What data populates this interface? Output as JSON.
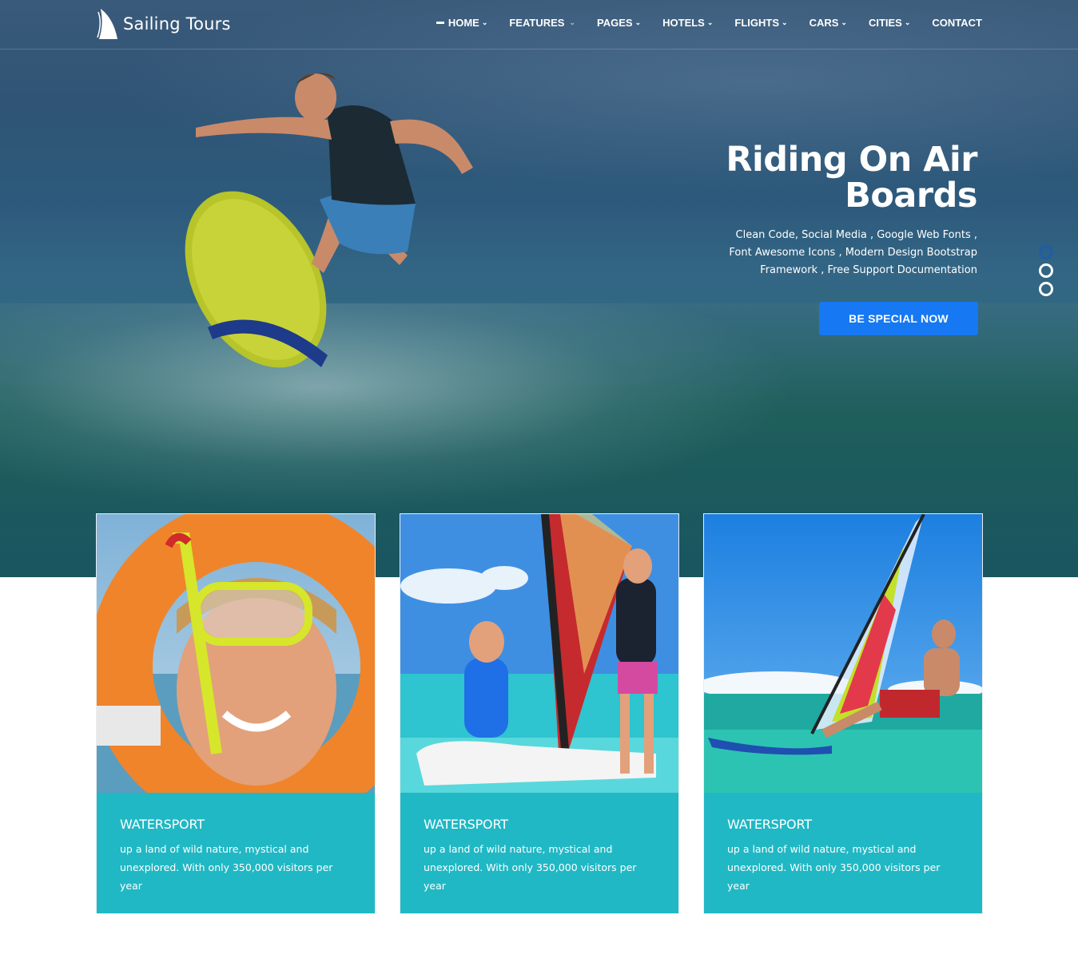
{
  "brand": {
    "name": "Sailing Tours",
    "logo_icon": "sail-icon"
  },
  "nav": {
    "items": [
      {
        "label": "HOME",
        "has_dropdown": true,
        "active": true
      },
      {
        "label": "FEATURES",
        "has_dropdown": true
      },
      {
        "label": "PAGES",
        "has_dropdown": true
      },
      {
        "label": "HOTELS",
        "has_dropdown": true
      },
      {
        "label": "FLIGHTS",
        "has_dropdown": true
      },
      {
        "label": "CARS",
        "has_dropdown": true
      },
      {
        "label": "CITIES",
        "has_dropdown": true
      },
      {
        "label": "CONTACT",
        "has_dropdown": false
      }
    ]
  },
  "hero": {
    "title_line1": "Riding On Air",
    "title_line2": "Boards",
    "subtitle": "Clean Code, Social Media , Google Web Fonts , Font Awesome Icons , Modern Design Bootstrap Framework , Free Support Documentation",
    "cta_label": "BE SPECIAL NOW",
    "slides": 3,
    "active_slide": 1
  },
  "cards": [
    {
      "title": "WATERSPORT",
      "desc": "up a land of wild nature, mystical and unexplored. With only 350,000 visitors per year",
      "image": "snorkel-girl-photo"
    },
    {
      "title": "WATERSPORT",
      "desc": "up a land of wild nature, mystical and unexplored. With only 350,000 visitors per year",
      "image": "windsurf-lesson-photo"
    },
    {
      "title": "WATERSPORT",
      "desc": "up a land of wild nature, mystical and unexplored. With only 350,000 visitors per year",
      "image": "windsurfer-photo"
    }
  ],
  "colors": {
    "accent_blue": "#1678f2",
    "card_teal": "#20b8c4",
    "dot_active": "#1f5ea6"
  }
}
